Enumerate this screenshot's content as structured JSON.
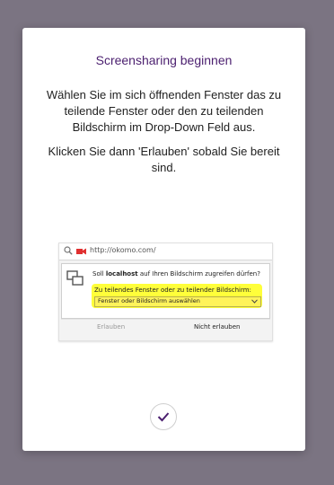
{
  "modal": {
    "title": "Screensharing beginnen",
    "paragraph1": "Wählen Sie im sich öffnenden Fenster das zu teilende Fenster oder den zu teilenden Bildschirm im Drop-Down Feld aus.",
    "paragraph2": "Klicken Sie dann 'Erlauben' sobald Sie bereit sind."
  },
  "prompt_image": {
    "url": "http://okomo.com/",
    "question_prefix": "Soll ",
    "question_host": "localhost",
    "question_suffix": " auf Ihren Bildschirm zugreifen dürfen?",
    "select_label": "Zu teilendes Fenster oder zu teilender Bildschirm:",
    "select_value": "Fenster oder Bildschirm auswählen",
    "allow_label": "Erlauben",
    "deny_label": "Nicht erlauben"
  },
  "icons": {
    "confirm": "checkmark-icon",
    "search": "search-icon",
    "camera": "camera-icon",
    "share": "screen-share-icon",
    "dropdown": "chevron-down-icon"
  },
  "colors": {
    "accent": "#4b1f6f",
    "highlight": "#ffff3a",
    "backdrop": "#7b7482"
  }
}
